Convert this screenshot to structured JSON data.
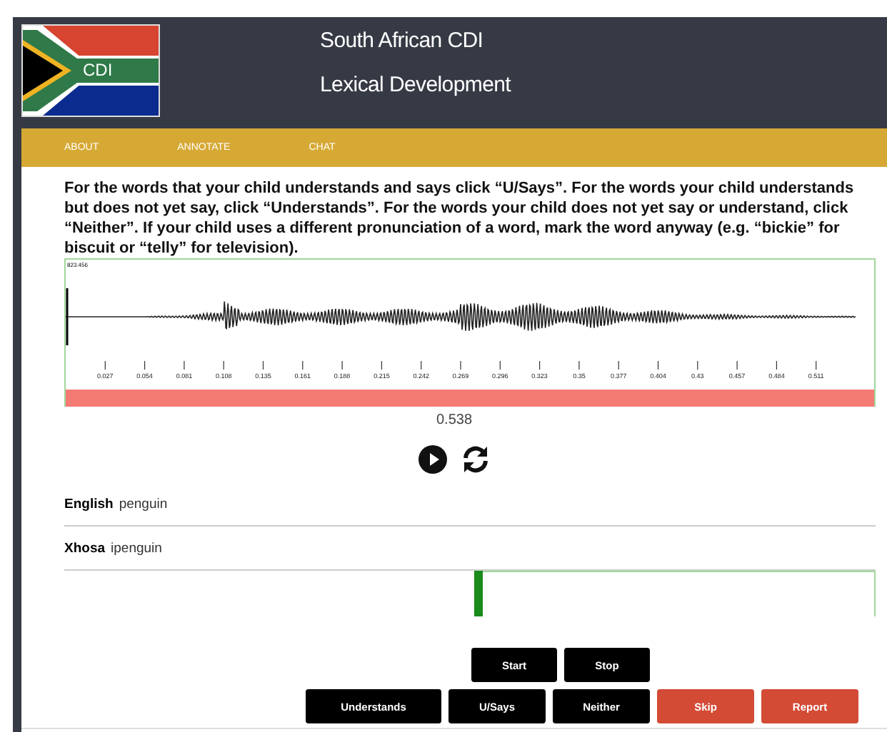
{
  "header": {
    "logo_text": "CDI",
    "title": "South African CDI",
    "subtitle": "Lexical Development"
  },
  "nav": [
    {
      "label": "ABOUT"
    },
    {
      "label": "ANNOTATE"
    },
    {
      "label": "CHAT"
    }
  ],
  "instructions": "For the words that your child understands and says click “U/Says”. For the words your child understands but does not yet say, click “Understands”. For the words your child does not yet say or understand, click “Neither”. If your child uses a different pronunciation of a word, mark the word anyway (e.g. “bickie” for biscuit or “telly” for television).",
  "waveform": {
    "max_label": "823.456",
    "tick_labels": [
      "0.027",
      "0.054",
      "0.081",
      "0.108",
      "0.135",
      "0.161",
      "0.188",
      "0.215",
      "0.242",
      "0.269",
      "0.296",
      "0.323",
      "0.35",
      "0.377",
      "0.404",
      "0.43",
      "0.457",
      "0.484",
      "0.511"
    ],
    "duration": "0.538"
  },
  "words": [
    {
      "language": "English",
      "word": "penguin"
    },
    {
      "language": "Xhosa",
      "word": "ipenguin"
    }
  ],
  "recorder": {
    "level": 0.506
  },
  "record_buttons": [
    {
      "label": "Start",
      "kind": "dark"
    },
    {
      "label": "Stop",
      "kind": "dark"
    }
  ],
  "answer_buttons": [
    {
      "label": "Understands",
      "kind": "dark"
    },
    {
      "label": "U/Says",
      "kind": "dark"
    },
    {
      "label": "Neither",
      "kind": "dark"
    },
    {
      "label": "Skip",
      "kind": "danger"
    },
    {
      "label": "Report",
      "kind": "danger"
    }
  ]
}
